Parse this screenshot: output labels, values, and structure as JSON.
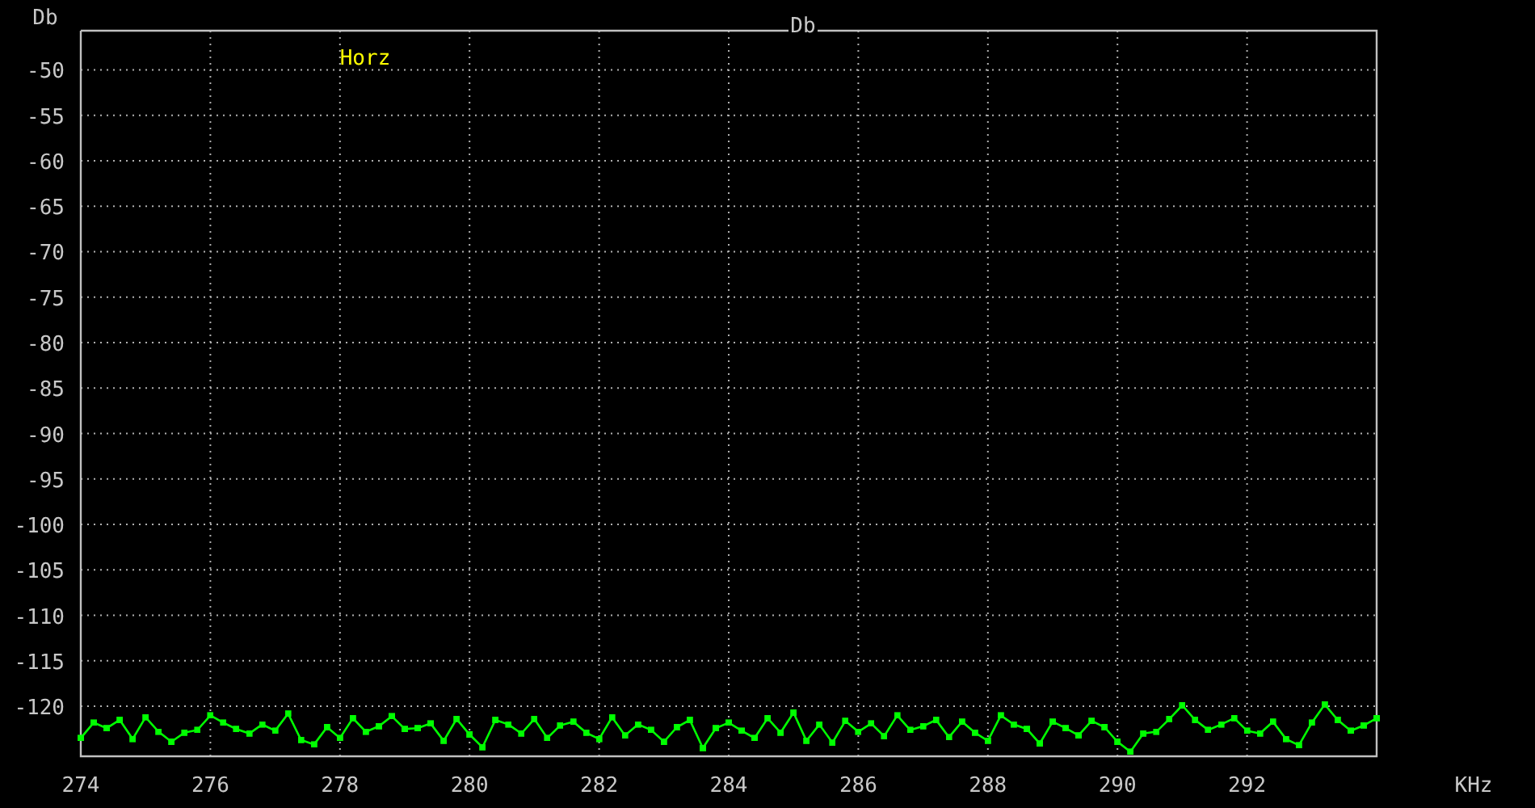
{
  "chart_data": {
    "type": "line",
    "title": "Db",
    "xlabel": "KHz",
    "ylabel": "Db",
    "x": [
      274,
      274.2,
      274.4,
      274.6,
      274.8,
      275,
      275.2,
      275.4,
      275.6,
      275.8,
      276,
      276.2,
      276.4,
      276.6,
      276.8,
      277,
      277.2,
      277.4,
      277.6,
      277.8,
      278,
      278.2,
      278.4,
      278.6,
      278.8,
      279,
      279.2,
      279.4,
      279.6,
      279.8,
      280,
      280.2,
      280.4,
      280.6,
      280.8,
      281,
      281.2,
      281.4,
      281.6,
      281.8,
      282,
      282.2,
      282.4,
      282.6,
      282.8,
      283,
      283.2,
      283.4,
      283.6,
      283.8,
      284,
      284.2,
      284.4,
      284.6,
      284.8,
      285,
      285.2,
      285.4,
      285.6,
      285.8,
      286,
      286.2,
      286.4,
      286.6,
      286.8,
      287,
      287.2,
      287.4,
      287.6,
      287.8,
      288,
      288.2,
      288.4,
      288.6,
      288.8,
      289,
      289.2,
      289.4,
      289.6,
      289.8,
      290,
      290.2,
      290.4,
      290.6,
      290.8,
      291,
      291.2,
      291.4,
      291.6,
      291.8,
      292,
      292.2,
      292.4,
      292.6,
      292.8,
      293,
      293.2,
      293.4,
      293.6,
      293.8,
      294
    ],
    "series": [
      {
        "name": "Horz",
        "color": "#00ff00",
        "values": [
          -123.5,
          -121.8,
          -122.4,
          -121.5,
          -123.6,
          -121.2,
          -122.8,
          -123.9,
          -122.9,
          -122.6,
          -121.0,
          -121.8,
          -122.5,
          -123.0,
          -122.0,
          -122.7,
          -120.8,
          -123.7,
          -124.2,
          -122.3,
          -123.5,
          -121.3,
          -122.8,
          -122.2,
          -121.1,
          -122.5,
          -122.4,
          -121.9,
          -123.8,
          -121.4,
          -123.1,
          -124.5,
          -121.5,
          -122.0,
          -123.0,
          -121.4,
          -123.5,
          -122.1,
          -121.7,
          -122.9,
          -123.6,
          -121.2,
          -123.2,
          -122.0,
          -122.6,
          -123.9,
          -122.3,
          -121.5,
          -124.6,
          -122.4,
          -121.8,
          -122.7,
          -123.5,
          -121.3,
          -122.9,
          -120.7,
          -123.8,
          -122.0,
          -124.0,
          -121.6,
          -122.8,
          -121.9,
          -123.3,
          -121.0,
          -122.6,
          -122.2,
          -121.5,
          -123.4,
          -121.7,
          -122.9,
          -123.8,
          -121.0,
          -122.0,
          -122.5,
          -124.1,
          -121.7,
          -122.4,
          -123.2,
          -121.6,
          -122.3,
          -123.9,
          -125.0,
          -123.0,
          -122.8,
          -121.4,
          -119.9,
          -121.5,
          -122.6,
          -122.0,
          -121.3,
          -122.7,
          -123.0,
          -121.7,
          -123.6,
          -124.3,
          -121.8,
          -119.8,
          -121.5,
          -122.7,
          -122.1,
          -121.3
        ]
      }
    ],
    "xlim": [
      274,
      294
    ],
    "ylim": [
      -125.5,
      -45.7
    ],
    "xticks": [
      274,
      276,
      278,
      280,
      282,
      284,
      286,
      288,
      290,
      292
    ],
    "yticks": [
      -50,
      -55,
      -60,
      -65,
      -70,
      -75,
      -80,
      -85,
      -90,
      -95,
      -100,
      -105,
      -110,
      -115,
      -120
    ],
    "grid": true
  }
}
